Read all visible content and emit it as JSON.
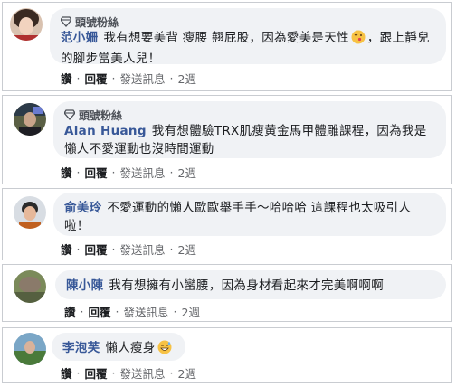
{
  "comments": [
    {
      "badge": "頭號粉絲",
      "author": "范小姍",
      "text": "我有想要美背 瘦腰 翹屁股，因為愛美是天性",
      "text_after_emoji": "，跟上靜兒的腳步當美人兒！",
      "emoji": "wink-kiss-emoji",
      "like": "讚",
      "reply": "回覆",
      "send": "發送訊息",
      "time": "2週"
    },
    {
      "badge": "頭號粉絲",
      "author": "Alan Huang",
      "text": "我有想體驗TRX肌瘦黃金馬甲體雕課程，因為我是懶人不愛運動也沒時間運動",
      "like": "讚",
      "reply": "回覆",
      "send": "發送訊息",
      "time": "2週"
    },
    {
      "author": "俞美玲",
      "text": "不愛運動的懶人歐歐舉手手～哈哈哈 這課程也太吸引人啦！",
      "like": "讚",
      "reply": "回覆",
      "send": "發送訊息",
      "time": "2週"
    },
    {
      "author": "陳小陳",
      "text": "我有想擁有小蠻腰，因為身材看起來才完美啊啊啊",
      "like": "讚",
      "reply": "回覆",
      "send": "發送訊息",
      "time": "2週"
    },
    {
      "author": "李泡芙",
      "text": "懶人瘦身",
      "emoji": "grin-sweat-emoji",
      "like": "讚",
      "reply": "回覆",
      "send": "發送訊息",
      "time": "2週"
    }
  ],
  "colors": {
    "author": "#385898",
    "bubble": "#f0f2f5",
    "border": "#c9ccd1",
    "meta": "#65676b"
  },
  "icons": {
    "badge": "diamond-badge-icon"
  }
}
